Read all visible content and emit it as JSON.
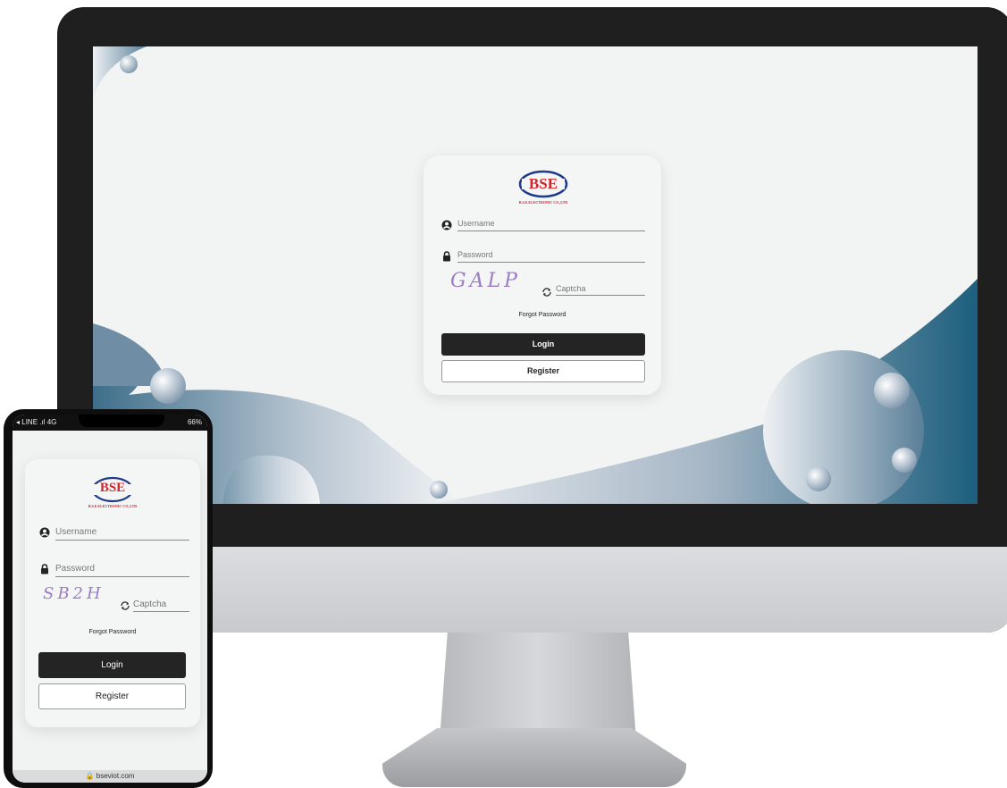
{
  "desktop": {
    "logo": {
      "text": "BSE",
      "subtitle": "B.S.E.ELECTRONIC CO.,LTD"
    },
    "username": {
      "placeholder": "Username",
      "icon": "user-circle-icon"
    },
    "password": {
      "placeholder": "Password",
      "icon": "lock-icon"
    },
    "captcha": {
      "image_text": "GALP",
      "placeholder": "Captcha",
      "icon": "refresh-icon"
    },
    "forgot_label": "Forgot Password",
    "login_label": "Login",
    "register_label": "Register"
  },
  "mobile": {
    "status_left": "◂ LINE .ıl 4G",
    "status_right": "66%",
    "logo": {
      "text": "BSE",
      "subtitle": "B.S.E.ELECTRONIC CO.,LTD"
    },
    "username": {
      "placeholder": "Username",
      "icon": "user-circle-icon"
    },
    "password": {
      "placeholder": "Password",
      "icon": "lock-icon"
    },
    "captcha": {
      "image_text": "SB2H",
      "placeholder": "Captcha",
      "icon": "refresh-icon"
    },
    "forgot_label": "Forgot Password",
    "login_label": "Login",
    "register_label": "Register",
    "url": "🔒 bseviot.com"
  },
  "colors": {
    "logo_red": "#d3232a",
    "logo_blue": "#1f3a8a",
    "wave_dark": "#1d5f7e",
    "button_dark": "#242424"
  }
}
